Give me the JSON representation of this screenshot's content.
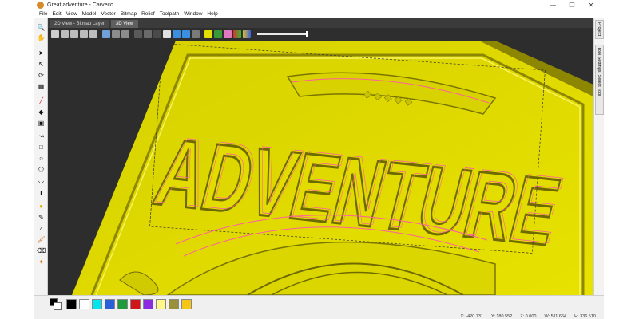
{
  "window": {
    "title": "Great adventure - Carveco",
    "controls": [
      "—",
      "❐",
      "✕"
    ]
  },
  "menu": [
    "File",
    "Edit",
    "View",
    "Model",
    "Vector",
    "Bitmap",
    "Relief",
    "Toolpath",
    "Window",
    "Help"
  ],
  "tabs": [
    {
      "label": "2D View - Bitmap Layer",
      "active": false
    },
    {
      "label": "3D View",
      "active": true
    }
  ],
  "right_panel": {
    "tabs": [
      "Project",
      "Tool Settings: Select Tool"
    ]
  },
  "palette": {
    "colors": [
      "#000000",
      "#ffffff",
      "#00e5ee",
      "#2a5fd6",
      "#1d9a3c",
      "#d0161b",
      "#8a2be2",
      "#fff78a",
      "#9a8f3a",
      "#f5c518"
    ]
  },
  "status": {
    "x": "X: -420.731",
    "y": "Y: 180.552",
    "z": "Z: 0.000",
    "w": "W: 511.664",
    "h": "H: 336.510"
  },
  "relief": {
    "big_word": "ADVENTURE",
    "colors": {
      "relief_yellow": "#e6e000",
      "relief_shadow": "#8c8600",
      "vector_pink": "#ff5fa0",
      "background": "#2d2d2d"
    }
  }
}
